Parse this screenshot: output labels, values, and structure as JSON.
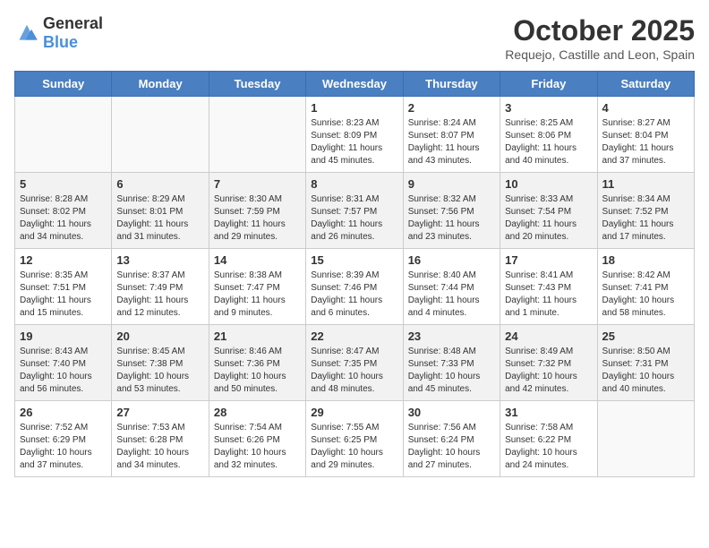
{
  "logo": {
    "general": "General",
    "blue": "Blue"
  },
  "title": {
    "month": "October 2025",
    "location": "Requejo, Castille and Leon, Spain"
  },
  "weekdays": [
    "Sunday",
    "Monday",
    "Tuesday",
    "Wednesday",
    "Thursday",
    "Friday",
    "Saturday"
  ],
  "weeks": [
    [
      {
        "day": "",
        "sunrise": "",
        "sunset": "",
        "daylight": ""
      },
      {
        "day": "",
        "sunrise": "",
        "sunset": "",
        "daylight": ""
      },
      {
        "day": "",
        "sunrise": "",
        "sunset": "",
        "daylight": ""
      },
      {
        "day": "1",
        "sunrise": "Sunrise: 8:23 AM",
        "sunset": "Sunset: 8:09 PM",
        "daylight": "Daylight: 11 hours and 45 minutes."
      },
      {
        "day": "2",
        "sunrise": "Sunrise: 8:24 AM",
        "sunset": "Sunset: 8:07 PM",
        "daylight": "Daylight: 11 hours and 43 minutes."
      },
      {
        "day": "3",
        "sunrise": "Sunrise: 8:25 AM",
        "sunset": "Sunset: 8:06 PM",
        "daylight": "Daylight: 11 hours and 40 minutes."
      },
      {
        "day": "4",
        "sunrise": "Sunrise: 8:27 AM",
        "sunset": "Sunset: 8:04 PM",
        "daylight": "Daylight: 11 hours and 37 minutes."
      }
    ],
    [
      {
        "day": "5",
        "sunrise": "Sunrise: 8:28 AM",
        "sunset": "Sunset: 8:02 PM",
        "daylight": "Daylight: 11 hours and 34 minutes."
      },
      {
        "day": "6",
        "sunrise": "Sunrise: 8:29 AM",
        "sunset": "Sunset: 8:01 PM",
        "daylight": "Daylight: 11 hours and 31 minutes."
      },
      {
        "day": "7",
        "sunrise": "Sunrise: 8:30 AM",
        "sunset": "Sunset: 7:59 PM",
        "daylight": "Daylight: 11 hours and 29 minutes."
      },
      {
        "day": "8",
        "sunrise": "Sunrise: 8:31 AM",
        "sunset": "Sunset: 7:57 PM",
        "daylight": "Daylight: 11 hours and 26 minutes."
      },
      {
        "day": "9",
        "sunrise": "Sunrise: 8:32 AM",
        "sunset": "Sunset: 7:56 PM",
        "daylight": "Daylight: 11 hours and 23 minutes."
      },
      {
        "day": "10",
        "sunrise": "Sunrise: 8:33 AM",
        "sunset": "Sunset: 7:54 PM",
        "daylight": "Daylight: 11 hours and 20 minutes."
      },
      {
        "day": "11",
        "sunrise": "Sunrise: 8:34 AM",
        "sunset": "Sunset: 7:52 PM",
        "daylight": "Daylight: 11 hours and 17 minutes."
      }
    ],
    [
      {
        "day": "12",
        "sunrise": "Sunrise: 8:35 AM",
        "sunset": "Sunset: 7:51 PM",
        "daylight": "Daylight: 11 hours and 15 minutes."
      },
      {
        "day": "13",
        "sunrise": "Sunrise: 8:37 AM",
        "sunset": "Sunset: 7:49 PM",
        "daylight": "Daylight: 11 hours and 12 minutes."
      },
      {
        "day": "14",
        "sunrise": "Sunrise: 8:38 AM",
        "sunset": "Sunset: 7:47 PM",
        "daylight": "Daylight: 11 hours and 9 minutes."
      },
      {
        "day": "15",
        "sunrise": "Sunrise: 8:39 AM",
        "sunset": "Sunset: 7:46 PM",
        "daylight": "Daylight: 11 hours and 6 minutes."
      },
      {
        "day": "16",
        "sunrise": "Sunrise: 8:40 AM",
        "sunset": "Sunset: 7:44 PM",
        "daylight": "Daylight: 11 hours and 4 minutes."
      },
      {
        "day": "17",
        "sunrise": "Sunrise: 8:41 AM",
        "sunset": "Sunset: 7:43 PM",
        "daylight": "Daylight: 11 hours and 1 minute."
      },
      {
        "day": "18",
        "sunrise": "Sunrise: 8:42 AM",
        "sunset": "Sunset: 7:41 PM",
        "daylight": "Daylight: 10 hours and 58 minutes."
      }
    ],
    [
      {
        "day": "19",
        "sunrise": "Sunrise: 8:43 AM",
        "sunset": "Sunset: 7:40 PM",
        "daylight": "Daylight: 10 hours and 56 minutes."
      },
      {
        "day": "20",
        "sunrise": "Sunrise: 8:45 AM",
        "sunset": "Sunset: 7:38 PM",
        "daylight": "Daylight: 10 hours and 53 minutes."
      },
      {
        "day": "21",
        "sunrise": "Sunrise: 8:46 AM",
        "sunset": "Sunset: 7:36 PM",
        "daylight": "Daylight: 10 hours and 50 minutes."
      },
      {
        "day": "22",
        "sunrise": "Sunrise: 8:47 AM",
        "sunset": "Sunset: 7:35 PM",
        "daylight": "Daylight: 10 hours and 48 minutes."
      },
      {
        "day": "23",
        "sunrise": "Sunrise: 8:48 AM",
        "sunset": "Sunset: 7:33 PM",
        "daylight": "Daylight: 10 hours and 45 minutes."
      },
      {
        "day": "24",
        "sunrise": "Sunrise: 8:49 AM",
        "sunset": "Sunset: 7:32 PM",
        "daylight": "Daylight: 10 hours and 42 minutes."
      },
      {
        "day": "25",
        "sunrise": "Sunrise: 8:50 AM",
        "sunset": "Sunset: 7:31 PM",
        "daylight": "Daylight: 10 hours and 40 minutes."
      }
    ],
    [
      {
        "day": "26",
        "sunrise": "Sunrise: 7:52 AM",
        "sunset": "Sunset: 6:29 PM",
        "daylight": "Daylight: 10 hours and 37 minutes."
      },
      {
        "day": "27",
        "sunrise": "Sunrise: 7:53 AM",
        "sunset": "Sunset: 6:28 PM",
        "daylight": "Daylight: 10 hours and 34 minutes."
      },
      {
        "day": "28",
        "sunrise": "Sunrise: 7:54 AM",
        "sunset": "Sunset: 6:26 PM",
        "daylight": "Daylight: 10 hours and 32 minutes."
      },
      {
        "day": "29",
        "sunrise": "Sunrise: 7:55 AM",
        "sunset": "Sunset: 6:25 PM",
        "daylight": "Daylight: 10 hours and 29 minutes."
      },
      {
        "day": "30",
        "sunrise": "Sunrise: 7:56 AM",
        "sunset": "Sunset: 6:24 PM",
        "daylight": "Daylight: 10 hours and 27 minutes."
      },
      {
        "day": "31",
        "sunrise": "Sunrise: 7:58 AM",
        "sunset": "Sunset: 6:22 PM",
        "daylight": "Daylight: 10 hours and 24 minutes."
      },
      {
        "day": "",
        "sunrise": "",
        "sunset": "",
        "daylight": ""
      }
    ]
  ]
}
